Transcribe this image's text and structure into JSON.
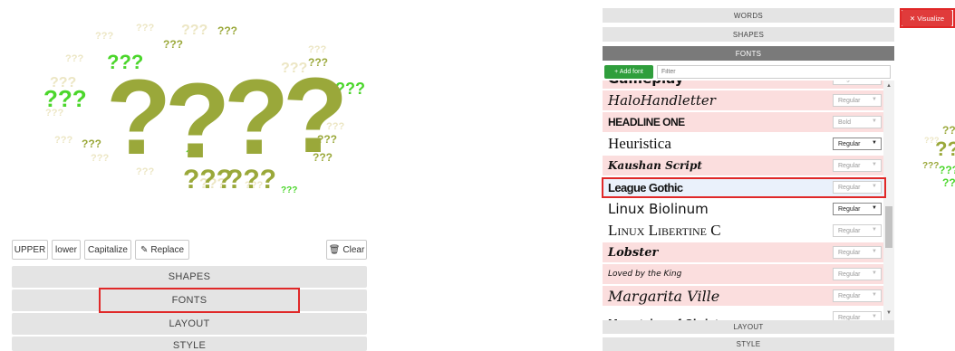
{
  "left_panel": {
    "case_buttons": {
      "upper": "UPPER",
      "lower": "lower",
      "capitalize": "Capitalize",
      "replace": "Replace",
      "clear": "Clear"
    },
    "accordion": {
      "shapes": "SHAPES",
      "fonts": "FONTS",
      "layout": "LAYOUT",
      "style": "STYLE"
    },
    "cloud_word": "???"
  },
  "right_panel": {
    "accordion": {
      "words": "WORDS",
      "shapes": "SHAPES",
      "fonts": "FONTS",
      "layout": "LAYOUT",
      "style": "STYLE"
    },
    "add_font_label": "+ Add font",
    "filter_placeholder": "Filter",
    "visualize_label": "Visualize",
    "fonts": [
      {
        "name": "Gameplay",
        "style": "Regular"
      },
      {
        "name": "HaloHandletter",
        "style": "Regular"
      },
      {
        "name": "HEADLINE ONE",
        "style": "Bold"
      },
      {
        "name": "Heuristica",
        "style": "Regular"
      },
      {
        "name": "Kaushan Script",
        "style": "Regular"
      },
      {
        "name": "League Gothic",
        "style": "Regular"
      },
      {
        "name": "Linux Biolinum",
        "style": "Regular"
      },
      {
        "name": "Linux Libertine C",
        "style": "Regular"
      },
      {
        "name": "Lobster",
        "style": "Regular"
      },
      {
        "name": "Loved by the King",
        "style": "Regular"
      },
      {
        "name": "Margarita Ville",
        "style": "Regular"
      },
      {
        "name": "Mountains of Christmas",
        "style": "Regular"
      }
    ]
  },
  "colors": {
    "olive": "#9aa83a",
    "green": "#4bd62b",
    "cream": "#ece6c4",
    "highlight": "#e02828",
    "pink_row": "#fbdede",
    "add_font_green": "#2f9e3c"
  }
}
